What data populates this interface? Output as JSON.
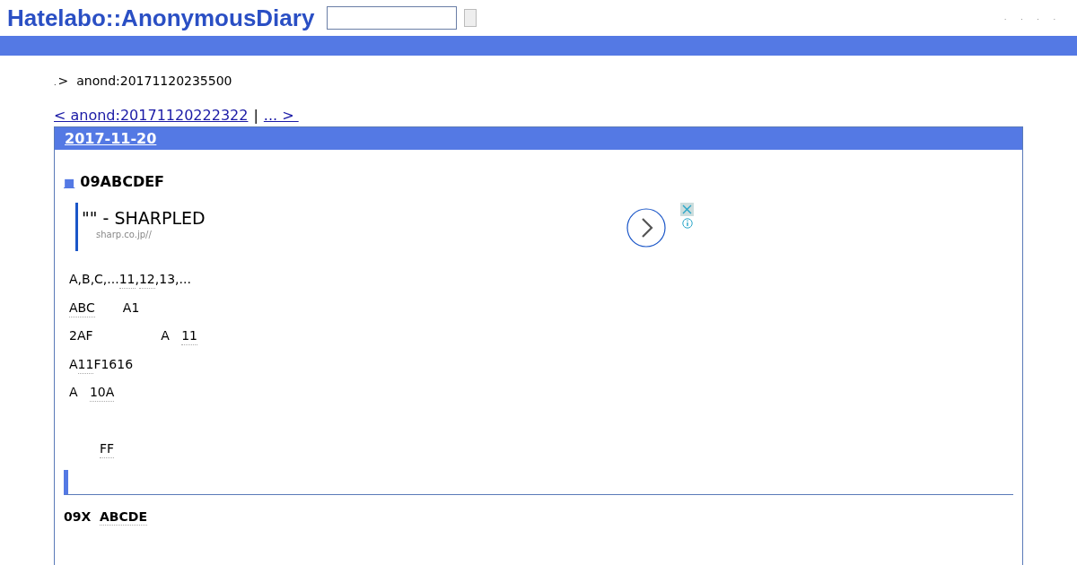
{
  "header": {
    "logo": "Hatelabo::AnonymousDiary",
    "links": [
      ".",
      ".",
      ".",
      "."
    ]
  },
  "breadcrumb": {
    "home": ".",
    "separator": ">",
    "current": "anond:20171120235500"
  },
  "pager": {
    "prev": "< anond:20171120222322",
    "separator": "|",
    "next": "... > "
  },
  "day": {
    "date": "2017-11-20",
    "entry": {
      "mark": "■",
      "title": "09ABCDEF",
      "ad": {
        "title": "\"\" - SHARPLED",
        "url": "sharp.co.jp//"
      },
      "paragraphs": [
        {
          "kind": "line",
          "segments": [
            {
              "text": "A,B,C,...",
              "keyword": false
            },
            {
              "text": "11",
              "keyword": true
            },
            {
              "text": ",",
              "keyword": false
            },
            {
              "text": "12",
              "keyword": true
            },
            {
              "text": ",13,...",
              "keyword": false
            }
          ]
        },
        {
          "kind": "line",
          "segments": [
            {
              "text": "ABC",
              "keyword": true
            },
            {
              "text": "       A1",
              "keyword": false
            }
          ]
        },
        {
          "kind": "line",
          "segments": [
            {
              "text": "2AF                 A   ",
              "keyword": false
            },
            {
              "text": "11",
              "keyword": true
            }
          ]
        },
        {
          "kind": "line",
          "segments": [
            {
              "text": "A",
              "keyword": false
            },
            {
              "text": "11",
              "keyword": true
            },
            {
              "text": "F1616",
              "keyword": false
            }
          ]
        },
        {
          "kind": "line",
          "segments": [
            {
              "text": "A   ",
              "keyword": false
            },
            {
              "text": "10A",
              "keyword": true
            }
          ]
        },
        {
          "kind": "after-break",
          "segments": [
            {
              "text": "FF",
              "keyword": true
            }
          ]
        }
      ],
      "subsection": {
        "title_segments": [
          {
            "text": "09X  ",
            "keyword": false
          },
          {
            "text": "ABCDE",
            "keyword": true
          }
        ]
      }
    }
  }
}
